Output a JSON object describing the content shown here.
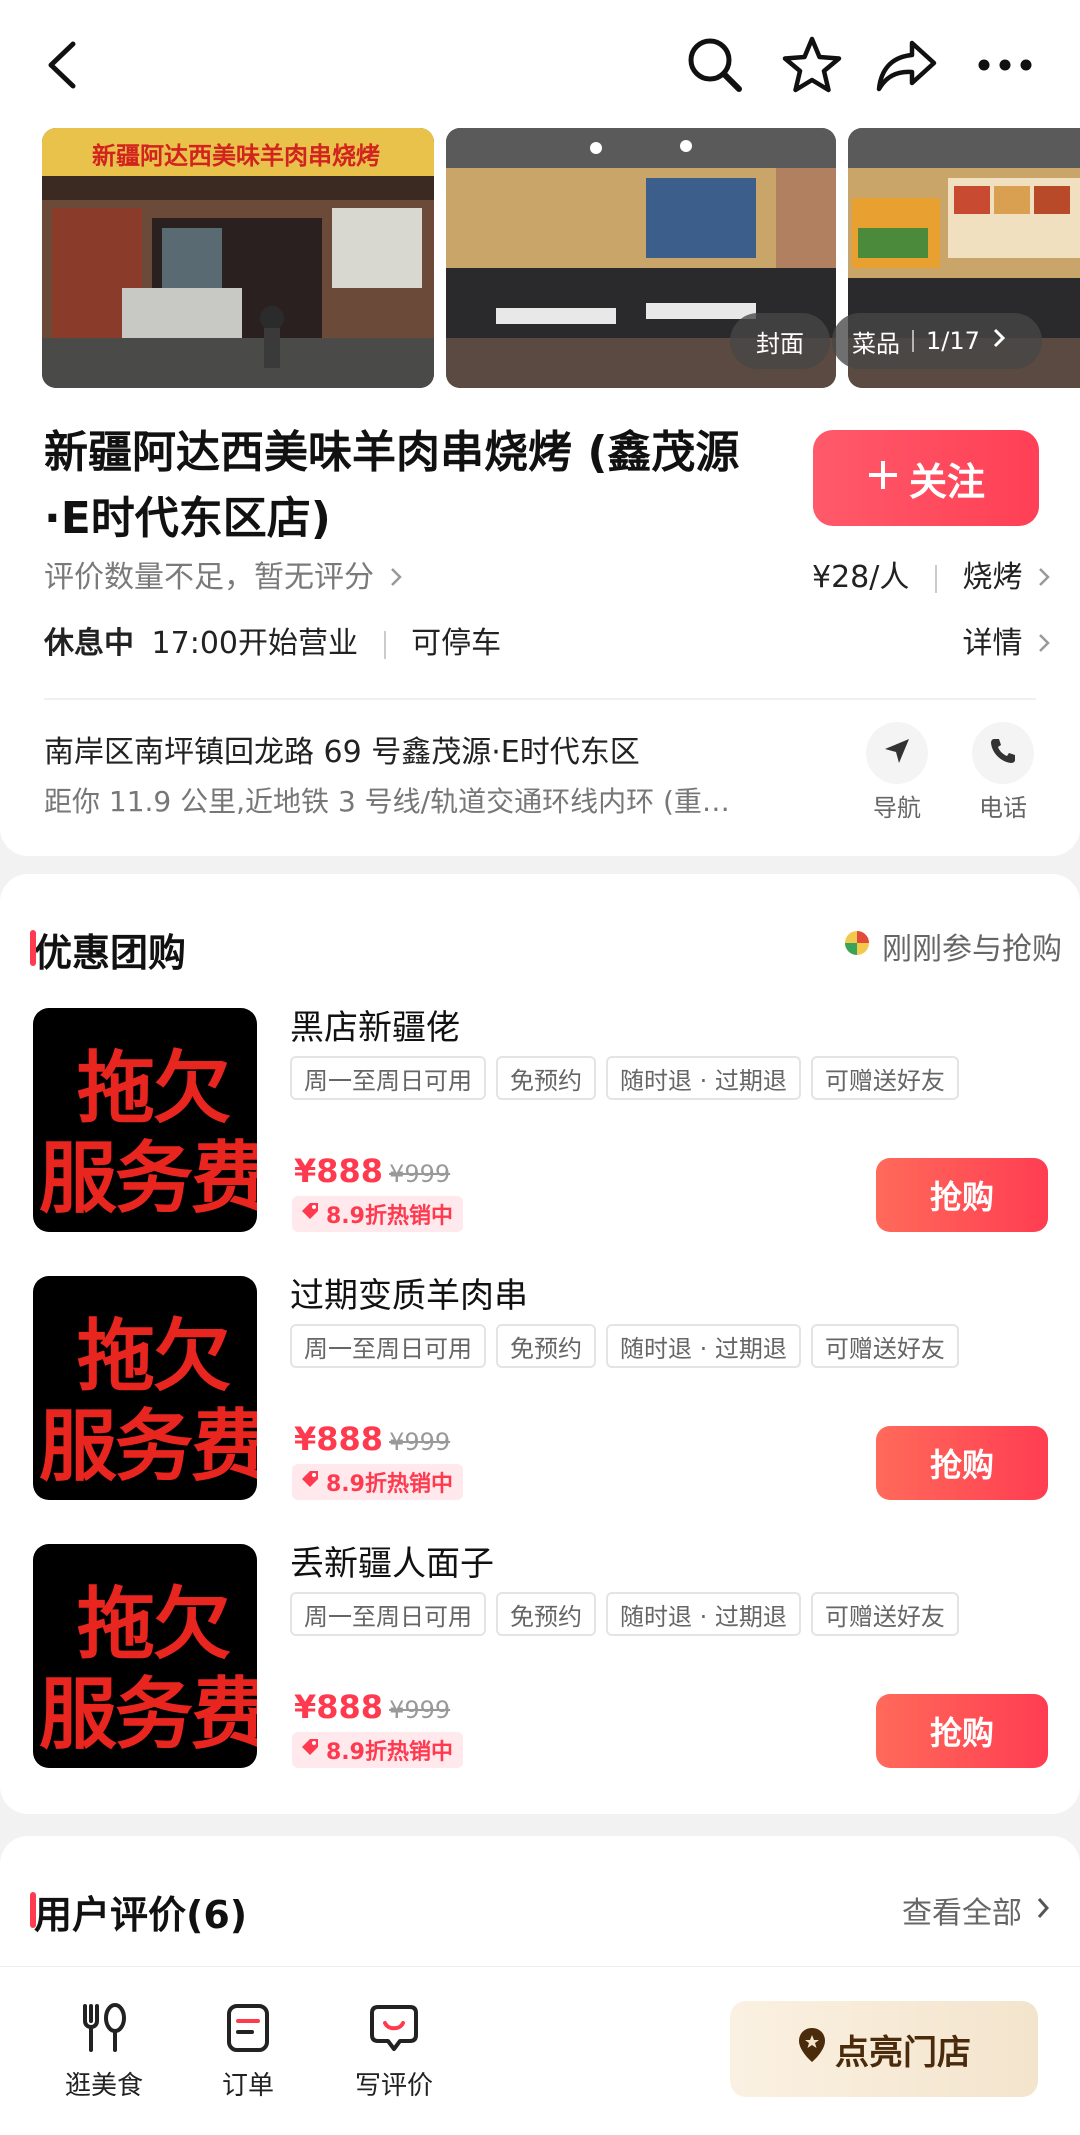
{
  "colors": {
    "accent": "#ff3f55",
    "price": "#ff3a4f",
    "tag_bg": "#ffe9ec",
    "light_btn": "#f3e4cc"
  },
  "topbar": {
    "icons": [
      "back-icon",
      "search-icon",
      "star-icon",
      "share-icon",
      "more-icon"
    ]
  },
  "photos": {
    "sign_text": "新疆阿达西美味羊肉串烧烤",
    "cover_label": "封面",
    "dishes_label": "菜品",
    "counter": "1/17"
  },
  "shop": {
    "title": "新疆阿达西美味羊肉串烧烤 (鑫茂源·E时代东区店)",
    "follow_label": "关注",
    "rating_text": "评价数量不足，暂无评分",
    "price_per_person": "¥28/人",
    "category": "烧烤",
    "status": "休息中",
    "hours": "17:00开始营业",
    "parking": "可停车",
    "details_label": "详情",
    "address": "南岸区南坪镇回龙路 69 号鑫茂源·E时代东区",
    "distance": "距你 11.9 公里,近地铁 3 号线/轨道交通环线内环 (重…",
    "nav_label": "导航",
    "phone_label": "电话"
  },
  "deals": {
    "title": "优惠团购",
    "recent_text": "刚刚参与抢购",
    "items": [
      {
        "name": "黑店新疆佬",
        "img_line1": "拖欠",
        "img_line2": "服务费",
        "tags": [
          "周一至周日可用",
          "免预约",
          "随时退 · 过期退",
          "可赠送好友"
        ],
        "price": "¥888",
        "orig_price": "¥999",
        "discount": "8.9折热销中",
        "buy_label": "抢购"
      },
      {
        "name": "过期变质羊肉串",
        "img_line1": "拖欠",
        "img_line2": "服务费",
        "tags": [
          "周一至周日可用",
          "免预约",
          "随时退 · 过期退",
          "可赠送好友"
        ],
        "price": "¥888",
        "orig_price": "¥999",
        "discount": "8.9折热销中",
        "buy_label": "抢购"
      },
      {
        "name": "丢新疆人面子",
        "img_line1": "拖欠",
        "img_line2": "服务费",
        "tags": [
          "周一至周日可用",
          "免预约",
          "随时退 · 过期退",
          "可赠送好友"
        ],
        "price": "¥888",
        "orig_price": "¥999",
        "discount": "8.9折热销中",
        "buy_label": "抢购"
      }
    ]
  },
  "reviews": {
    "title": "用户评价(6)",
    "view_all": "查看全部"
  },
  "bottom_nav": {
    "food_label": "逛美食",
    "orders_label": "订单",
    "review_label": "写评价",
    "light_label": "点亮门店"
  }
}
